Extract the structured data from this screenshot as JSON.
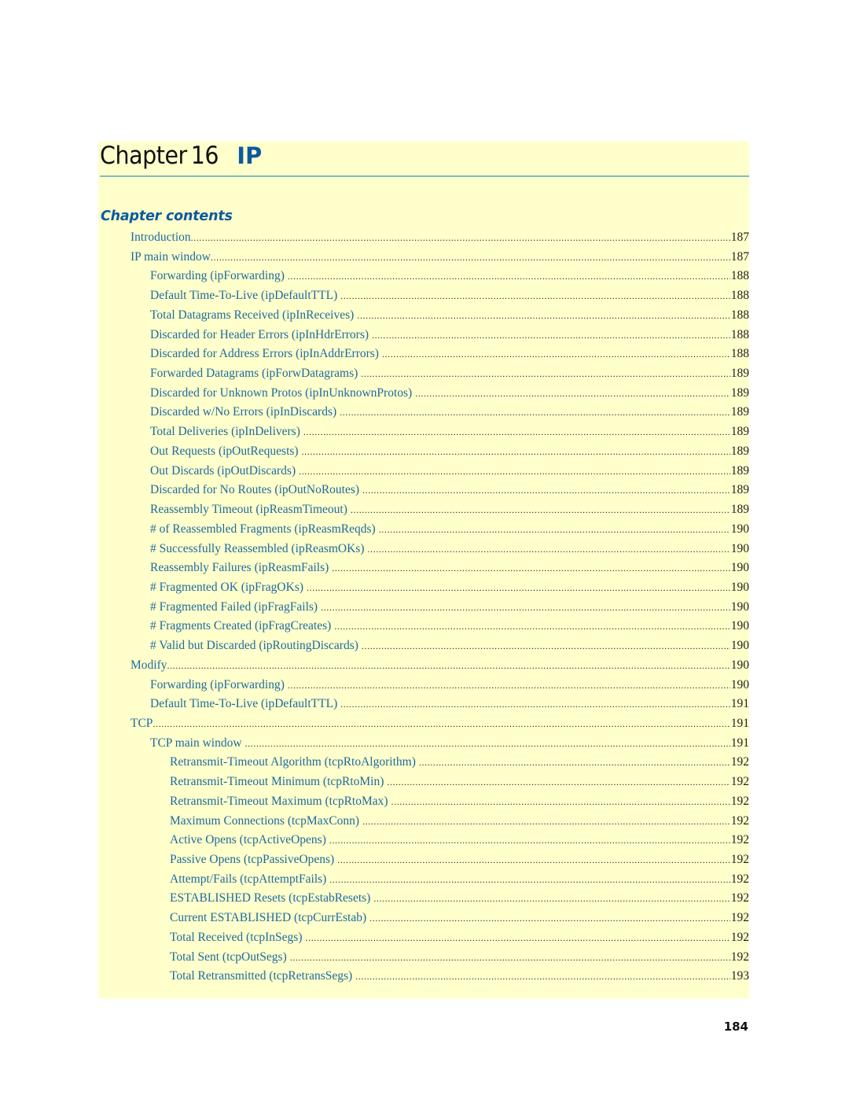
{
  "chapter": {
    "word": "Chapter",
    "number": "16",
    "title": "IP"
  },
  "contents_heading": "Chapter contents",
  "toc": [
    {
      "level": 1,
      "label": "Introduction",
      "page": "187"
    },
    {
      "level": 1,
      "label": "IP main window",
      "page": "187"
    },
    {
      "level": 2,
      "label": "Forwarding (ipForwarding)",
      "page": "188"
    },
    {
      "level": 2,
      "label": "Default Time-To-Live (ipDefaultTTL)",
      "page": "188"
    },
    {
      "level": 2,
      "label": "Total Datagrams Received (ipInReceives)",
      "page": "188"
    },
    {
      "level": 2,
      "label": "Discarded for Header Errors (ipInHdrErrors)",
      "page": "188"
    },
    {
      "level": 2,
      "label": "Discarded for Address Errors (ipInAddrErrors)",
      "page": "188"
    },
    {
      "level": 2,
      "label": "Forwarded Datagrams (ipForwDatagrams)",
      "page": "189"
    },
    {
      "level": 2,
      "label": "Discarded for Unknown Protos (ipInUnknownProtos)",
      "page": "189"
    },
    {
      "level": 2,
      "label": "Discarded w/No Errors (ipInDiscards)",
      "page": "189"
    },
    {
      "level": 2,
      "label": "Total Deliveries (ipInDelivers)",
      "page": "189"
    },
    {
      "level": 2,
      "label": "Out Requests (ipOutRequests)",
      "page": "189"
    },
    {
      "level": 2,
      "label": "Out Discards (ipOutDiscards)",
      "page": "189"
    },
    {
      "level": 2,
      "label": "Discarded for No Routes (ipOutNoRoutes)",
      "page": "189"
    },
    {
      "level": 2,
      "label": "Reassembly Timeout (ipReasmTimeout)",
      "page": "189"
    },
    {
      "level": 2,
      "label": "# of Reassembled Fragments (ipReasmReqds)",
      "page": "190"
    },
    {
      "level": 2,
      "label": "# Successfully Reassembled (ipReasmOKs)",
      "page": "190"
    },
    {
      "level": 2,
      "label": "Reassembly Failures (ipReasmFails)",
      "page": "190"
    },
    {
      "level": 2,
      "label": "# Fragmented OK (ipFragOKs)",
      "page": "190"
    },
    {
      "level": 2,
      "label": "# Fragmented Failed (ipFragFails)",
      "page": "190"
    },
    {
      "level": 2,
      "label": "# Fragments Created (ipFragCreates)",
      "page": "190"
    },
    {
      "level": 2,
      "label": "# Valid but Discarded (ipRoutingDiscards)",
      "page": "190"
    },
    {
      "level": 1,
      "label": "Modify",
      "page": "190"
    },
    {
      "level": 2,
      "label": "Forwarding (ipForwarding)",
      "page": "190"
    },
    {
      "level": 2,
      "label": "Default Time-To-Live (ipDefaultTTL)",
      "page": "191"
    },
    {
      "level": 1,
      "label": "TCP",
      "page": "191"
    },
    {
      "level": 2,
      "label": "TCP main window",
      "page": "191"
    },
    {
      "level": 3,
      "label": "Retransmit-Timeout Algorithm (tcpRtoAlgorithm)",
      "page": "192"
    },
    {
      "level": 3,
      "label": "Retransmit-Timeout Minimum (tcpRtoMin)",
      "page": "192"
    },
    {
      "level": 3,
      "label": "Retransmit-Timeout Maximum (tcpRtoMax)",
      "page": "192"
    },
    {
      "level": 3,
      "label": "Maximum Connections (tcpMaxConn)",
      "page": "192"
    },
    {
      "level": 3,
      "label": "Active Opens (tcpActiveOpens)",
      "page": "192"
    },
    {
      "level": 3,
      "label": "Passive Opens (tcpPassiveOpens)",
      "page": "192"
    },
    {
      "level": 3,
      "label": "Attempt/Fails (tcpAttemptFails)",
      "page": "192"
    },
    {
      "level": 3,
      "label": "ESTABLISHED Resets (tcpEstabResets)",
      "page": "192"
    },
    {
      "level": 3,
      "label": "Current ESTABLISHED (tcpCurrEstab)",
      "page": "192"
    },
    {
      "level": 3,
      "label": "Total Received (tcpInSegs)",
      "page": "192"
    },
    {
      "level": 3,
      "label": "Total Sent (tcpOutSegs)",
      "page": "192"
    },
    {
      "level": 3,
      "label": "Total Retransmitted (tcpRetransSegs)",
      "page": "193"
    }
  ],
  "page_number": "184",
  "colors": {
    "panel_background": "#ffffcc",
    "accent_blue": "#0c5a9e",
    "link_blue": "#1e6a9c",
    "rule_teal": "#7ebfc1"
  }
}
